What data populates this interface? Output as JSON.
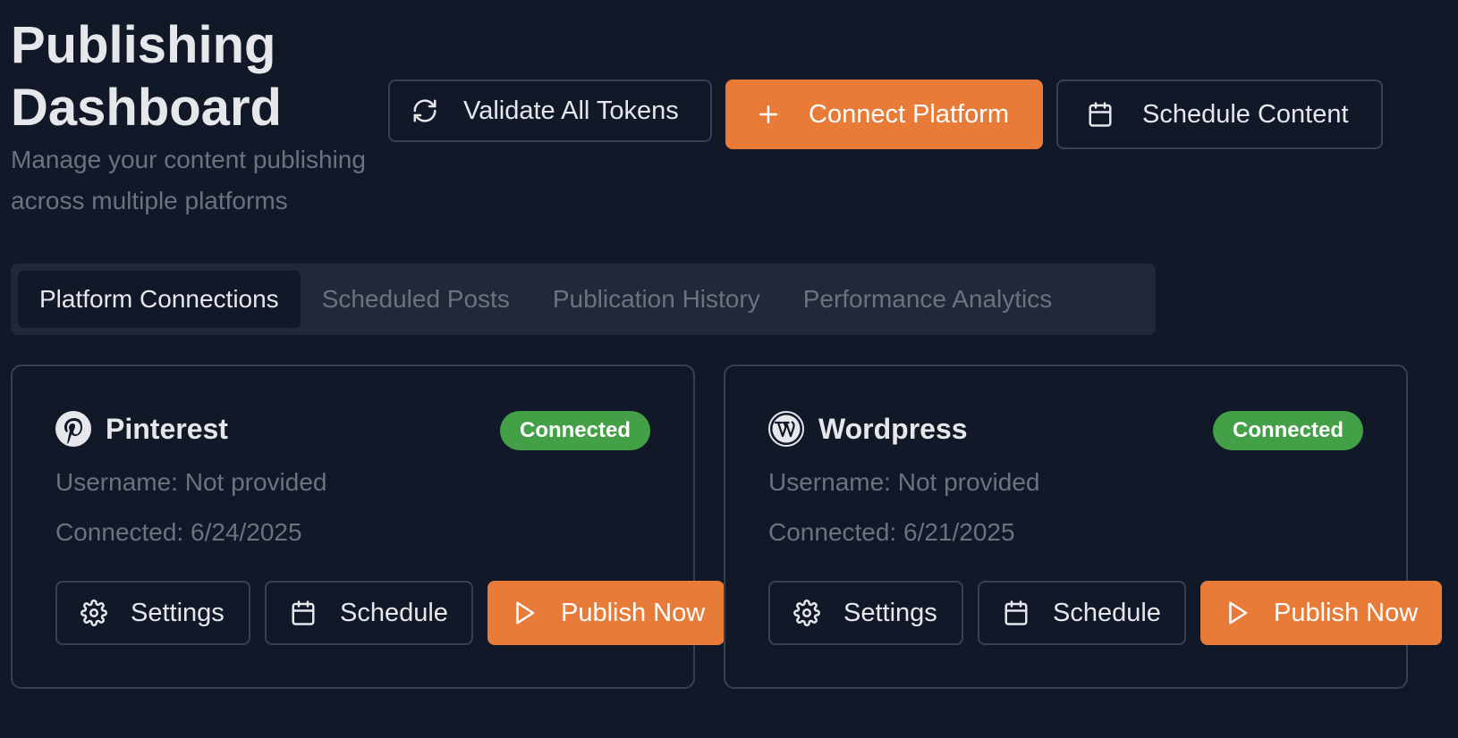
{
  "header": {
    "title": "Publishing Dashboard",
    "subtitle": "Manage your content publishing across multiple platforms"
  },
  "actions": {
    "validate_label": "Validate All Tokens",
    "connect_label": "Connect Platform",
    "schedule_label": "Schedule Content"
  },
  "tabs": [
    {
      "label": "Platform Connections",
      "active": true
    },
    {
      "label": "Scheduled Posts",
      "active": false
    },
    {
      "label": "Publication History",
      "active": false
    },
    {
      "label": "Performance Analytics",
      "active": false
    }
  ],
  "platforms": [
    {
      "name": "Pinterest",
      "icon": "pinterest-icon",
      "status": "Connected",
      "username": "Username: Not provided",
      "connected": "Connected: 6/24/2025",
      "settings_label": "Settings",
      "schedule_label": "Schedule",
      "publish_label": "Publish Now"
    },
    {
      "name": "Wordpress",
      "icon": "wordpress-icon",
      "status": "Connected",
      "username": "Username: Not provided",
      "connected": "Connected: 6/21/2025",
      "settings_label": "Settings",
      "schedule_label": "Schedule",
      "publish_label": "Publish Now"
    }
  ],
  "colors": {
    "background": "#111827",
    "accent": "#e97b38",
    "success": "#43a047",
    "muted": "#6b7280",
    "border": "#374151"
  }
}
